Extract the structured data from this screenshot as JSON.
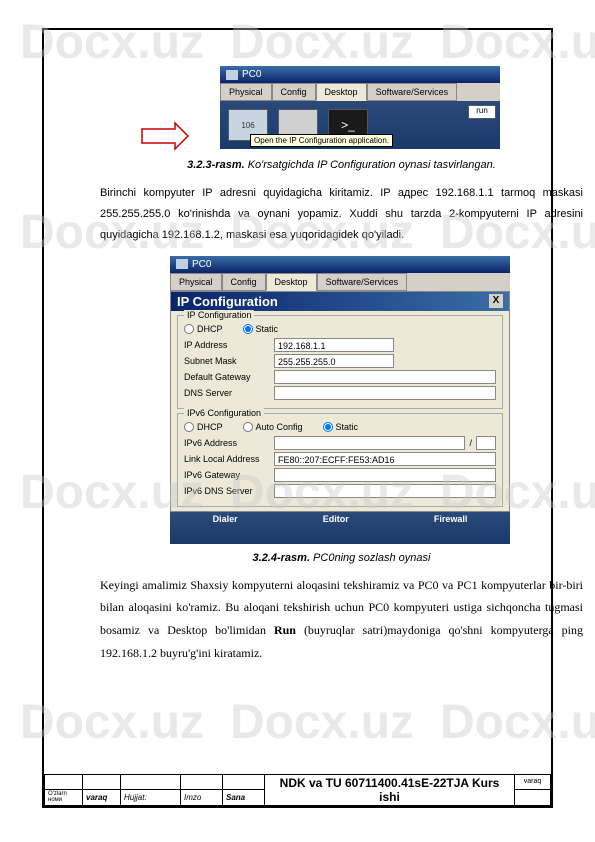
{
  "watermark": "Docx.uz",
  "screenshot1": {
    "winTitle": "PC0",
    "tabs": [
      "Physical",
      "Config",
      "Desktop",
      "Software/Services"
    ],
    "activeTab": 2,
    "icon106": "106",
    "terminal": ">_",
    "runLabel": "run",
    "tooltip": "Open the IP Configuration application."
  },
  "caption1": {
    "num": "3.2.3-rasm.",
    "text": " Ko'rsatgichda IP Configuration oynasi tasvirlangan."
  },
  "para1": "Birinchi kompyuter IP adresni quyidagicha kiritamiz. IP адрес 192.168.1.1 tarmoq maskasi 255.255.255.0 ko'rinishda va oynani yopamiz. Xuddi shu tarzda 2-kompyuterni IP adresini quyidagicha 192.168.1.2, maskasi esa yuqoridagidek qo'yiladi.",
  "screenshot2": {
    "winTitle": "PC0",
    "tabs": [
      "Physical",
      "Config",
      "Desktop",
      "Software/Services"
    ],
    "headerTitle": "IP Configuration",
    "group1": {
      "legend": "IP Configuration",
      "radio": [
        "DHCP",
        "Static"
      ],
      "selected": 1,
      "fields": {
        "ip_lbl": "IP Address",
        "ip_val": "192.168.1.1",
        "mask_lbl": "Subnet Mask",
        "mask_val": "255.255.255.0",
        "gw_lbl": "Default Gateway",
        "gw_val": "",
        "dns_lbl": "DNS Server",
        "dns_val": ""
      }
    },
    "group2": {
      "legend": "IPv6 Configuration",
      "radio": [
        "DHCP",
        "Auto Config",
        "Static"
      ],
      "selected": 2,
      "fields": {
        "addr_lbl": "IPv6 Address",
        "addr_val": "",
        "lla_lbl": "Link Local Address",
        "lla_val": "FE80::207:ECFF:FE53:AD16",
        "gw_lbl": "IPv6 Gateway",
        "gw_val": "",
        "dns_lbl": "IPv6 DNS Server",
        "dns_val": ""
      }
    },
    "bottom": [
      "Dialer",
      "Editor",
      "Firewall"
    ]
  },
  "caption2": {
    "num": "3.2.4-rasm.",
    "text": " PC0ning sozlash oynasi"
  },
  "para2_a": "Keyingi amalimiz Shaxsiy kompyuterni aloqasini tekshiramiz va PC0 va PC1 kompyuterlar bir-biri bilan aloqasini ko'ramiz. Bu aloqani tekshirish uchun PC0 kompyuteri ustiga sichqoncha tugmasi bosamiz va Desktop bo'limidan ",
  "para2_run": "Run",
  "para2_b": " (buyruqlar satri)maydoniga qo'shni kompyuterga ping 192.168.1.2 buyru'g'ini kiratamiz.",
  "footer": {
    "title": "NDK va TU 60711400.41sE-22TJA Kurs ishi",
    "varaqHdr": "varaq",
    "col1": "O'zlarn номи",
    "col2": "varaq",
    "col3": "Hujjat:",
    "col4": "Imzo",
    "col5": "Sana"
  }
}
